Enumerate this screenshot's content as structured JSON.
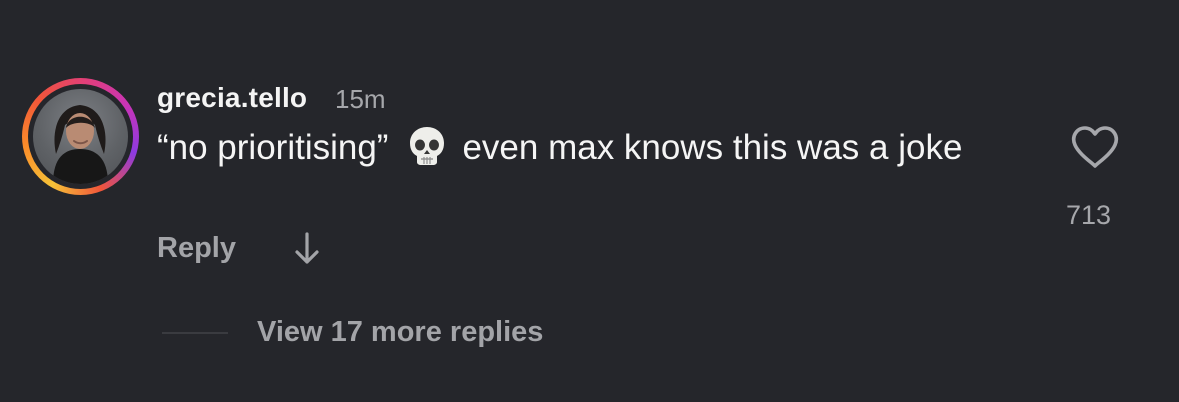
{
  "comment": {
    "username": "grecia.tello",
    "time": "15m",
    "text_before": "“no prioritising”",
    "emoji": "skull-icon",
    "text_after": "even max knows this was a joke",
    "reply_label": "Reply",
    "like_count": "713"
  },
  "replies": {
    "view_more_label": "View 17 more replies"
  },
  "colors": {
    "background": "#25262b",
    "primary_text": "#f5f5f5",
    "secondary_text": "#a6a7ab"
  }
}
